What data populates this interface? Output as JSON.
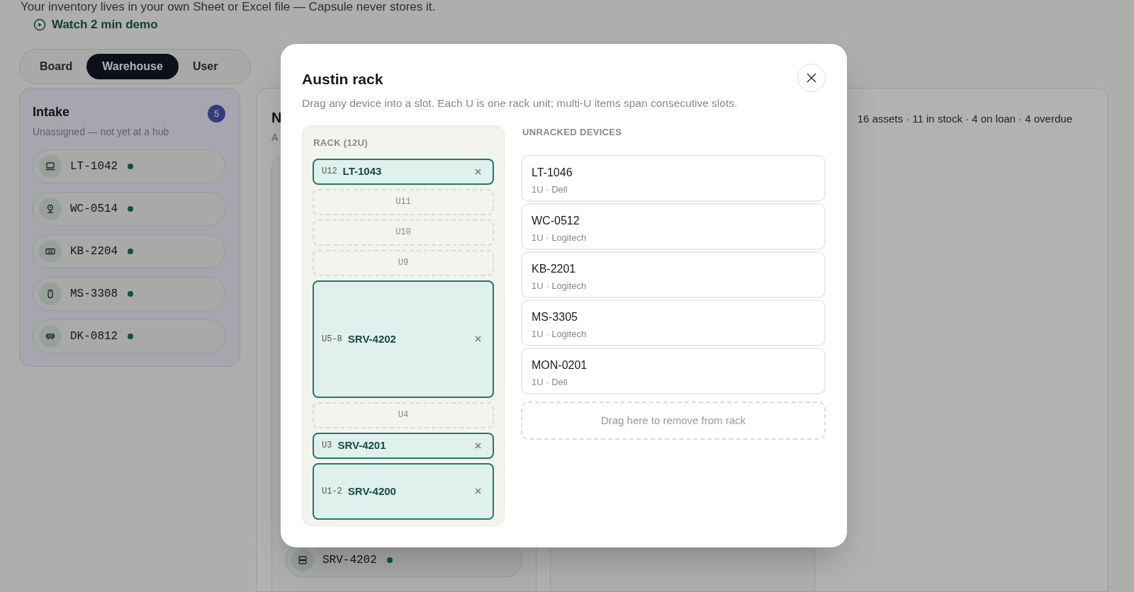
{
  "page": {
    "intro": "Your inventory lives in your own Sheet or Excel file — Capsule never stores it.",
    "demo_link": "Watch 2 min demo"
  },
  "view_tabs": [
    {
      "label": "Board",
      "selected": false
    },
    {
      "label": "Warehouse",
      "selected": true
    },
    {
      "label": "User",
      "selected": false
    }
  ],
  "intake": {
    "title": "Intake",
    "subtitle": "Unassigned — not yet at a hub",
    "count": "5",
    "items": [
      {
        "kind": "laptop",
        "code": "LT-1042"
      },
      {
        "kind": "webcam",
        "code": "WC-0514"
      },
      {
        "kind": "keyboard",
        "code": "KB-2204"
      },
      {
        "kind": "mouse",
        "code": "MS-3308"
      },
      {
        "kind": "dock",
        "code": "DK-0812"
      }
    ]
  },
  "hub_panel": {
    "title": "N",
    "subtitle": "A",
    "stats": "16 assets · 11 in stock · 4 on loan · 4 overdue",
    "items": [
      {
        "kind": "server",
        "code": "SRV-4202"
      }
    ]
  },
  "modal": {
    "title": "Austin rack",
    "description": "Drag any device into a slot. Each U is one rack unit; multi-U items span consecutive slots.",
    "rack": {
      "heading": "RACK (12U)",
      "slots": [
        {
          "kind": "device",
          "label": "U12",
          "name": "LT-1043"
        },
        {
          "kind": "empty",
          "label": "U11"
        },
        {
          "kind": "empty",
          "label": "U10"
        },
        {
          "kind": "empty",
          "label": "U9"
        },
        {
          "kind": "device",
          "label": "U5-8",
          "name": "SRV-4202"
        },
        {
          "kind": "empty",
          "label": "U4"
        },
        {
          "kind": "device",
          "label": "U3",
          "name": "SRV-4201"
        },
        {
          "kind": "device",
          "label": "U1-2",
          "name": "SRV-4200"
        }
      ]
    },
    "unracked": {
      "heading": "UNRACKED DEVICES",
      "devices": [
        {
          "code": "LT-1046",
          "meta": "1U · Dell"
        },
        {
          "code": "WC-0512",
          "meta": "1U · Logitech"
        },
        {
          "code": "KB-2201",
          "meta": "1U · Logitech"
        },
        {
          "code": "MS-3305",
          "meta": "1U · Logitech"
        },
        {
          "code": "MON-0201",
          "meta": "1U · Dell"
        }
      ],
      "drop_zone": "Drag here to remove from rack"
    }
  }
}
